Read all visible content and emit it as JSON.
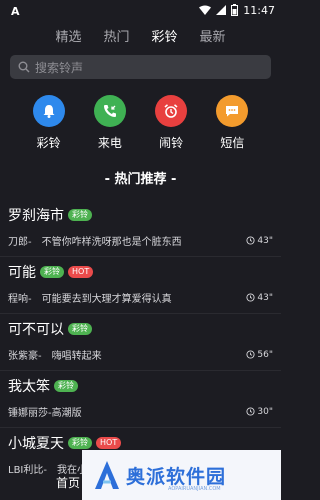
{
  "status_bar": {
    "time": "11:47",
    "left_icon": "A"
  },
  "top_tabs": [
    {
      "label": "精选",
      "active": false
    },
    {
      "label": "热门",
      "active": false
    },
    {
      "label": "彩铃",
      "active": true
    },
    {
      "label": "最新",
      "active": false
    }
  ],
  "search": {
    "placeholder": "搜索铃声"
  },
  "categories": [
    {
      "label": "彩铃",
      "color": "#2e89ec",
      "icon": "bell-icon"
    },
    {
      "label": "来电",
      "color": "#3fb153",
      "icon": "phone-icon"
    },
    {
      "label": "闹铃",
      "color": "#e8403f",
      "icon": "alarm-clock-icon"
    },
    {
      "label": "短信",
      "color": "#f39b2d",
      "icon": "message-icon"
    }
  ],
  "section_title": "- 热门推荐 -",
  "badges": {
    "cl": "彩铃",
    "hot": "HOT"
  },
  "songs": [
    {
      "title": "罗刹海市",
      "desc": "刀郎-　不管你咋样洗呀那也是个脏东西",
      "duration": "43\"",
      "cl": true,
      "hot": false
    },
    {
      "title": "可能",
      "desc": "程响-　可能要去到大理才算爱得认真",
      "duration": "43\"",
      "cl": true,
      "hot": true
    },
    {
      "title": "可不可以",
      "desc": "张紫豪-　嗨唱转起来",
      "duration": "56\"",
      "cl": true,
      "hot": false
    },
    {
      "title": "我太笨",
      "desc": "锤娜丽莎-高潮版",
      "duration": "30\"",
      "cl": true,
      "hot": false
    },
    {
      "title": "小城夏天",
      "desc": "LBI利比-　我在小城",
      "duration": "",
      "cl": true,
      "hot": true
    }
  ],
  "bottom_nav": {
    "home_label": "首页"
  },
  "watermark": {
    "text": "奥派软件园",
    "sub": "AOPAIRUANJIAN.COM"
  }
}
